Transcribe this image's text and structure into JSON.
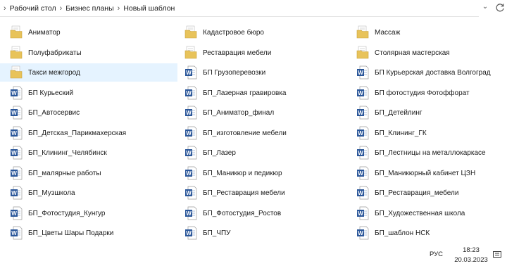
{
  "breadcrumb": [
    "Рабочий стол",
    "Бизнес планы",
    "Новый шаблон"
  ],
  "items": [
    {
      "name": "Аниматор",
      "type": "folder",
      "selected": false
    },
    {
      "name": "Кадастровое бюро",
      "type": "folder",
      "selected": false
    },
    {
      "name": "Массаж",
      "type": "folder",
      "selected": false
    },
    {
      "name": "Полуфабрикаты",
      "type": "folder",
      "selected": false
    },
    {
      "name": "Реставрация мебели",
      "type": "folder",
      "selected": false
    },
    {
      "name": "Столярная мастерская",
      "type": "folder",
      "selected": false
    },
    {
      "name": "Такси межгород",
      "type": "folder",
      "selected": true
    },
    {
      "name": "БП Грузоперевозки",
      "type": "word",
      "selected": false
    },
    {
      "name": "БП Курьерская доставка Волгоград",
      "type": "word",
      "selected": false
    },
    {
      "name": "БП Курьеский",
      "type": "word",
      "selected": false
    },
    {
      "name": "БП_Лазерная гравировка",
      "type": "word",
      "selected": false
    },
    {
      "name": "БП фотостудия Фотоффорат",
      "type": "word",
      "selected": false
    },
    {
      "name": "БП_Автосервис",
      "type": "word",
      "selected": false
    },
    {
      "name": "БП_Аниматор_финал",
      "type": "word",
      "selected": false
    },
    {
      "name": "БП_Детейлинг",
      "type": "word",
      "selected": false
    },
    {
      "name": "БП_Детская_Парикмахерская",
      "type": "word",
      "selected": false
    },
    {
      "name": "БП_изготовление мебели",
      "type": "word",
      "selected": false
    },
    {
      "name": "БП_Клининг_ГК",
      "type": "word",
      "selected": false
    },
    {
      "name": "БП_Клининг_Челябинск",
      "type": "word",
      "selected": false
    },
    {
      "name": "БП_Лазер",
      "type": "word",
      "selected": false
    },
    {
      "name": "БП_Лестницы на металлокаркасе",
      "type": "word",
      "selected": false
    },
    {
      "name": "БП_малярные работы",
      "type": "word",
      "selected": false
    },
    {
      "name": "БП_Маникюр и педикюр",
      "type": "word",
      "selected": false
    },
    {
      "name": "БП_Маникюрный кабинет ЦЗН",
      "type": "word",
      "selected": false
    },
    {
      "name": "БП_Музшкола",
      "type": "word",
      "selected": false
    },
    {
      "name": "БП_Реставрация мебели",
      "type": "word",
      "selected": false
    },
    {
      "name": "БП_Реставрация_мебели",
      "type": "word",
      "selected": false
    },
    {
      "name": "БП_Фотостудия_Кунгур",
      "type": "word",
      "selected": false
    },
    {
      "name": "БП_Фотостудия_Ростов",
      "type": "word",
      "selected": false
    },
    {
      "name": "БП_Художественная школа",
      "type": "word",
      "selected": false
    },
    {
      "name": "БП_Цветы Шары Подарки",
      "type": "word",
      "selected": false
    },
    {
      "name": "БП_ЧПУ",
      "type": "word",
      "selected": false
    },
    {
      "name": "БП_шаблон НСК",
      "type": "word",
      "selected": false
    }
  ],
  "taskbar": {
    "language": "РУС",
    "time": "18:23",
    "date": "20.03.2023"
  },
  "colors": {
    "selection": "#e5f3ff",
    "folder": "#e8c35a",
    "word": "#2b579a"
  }
}
